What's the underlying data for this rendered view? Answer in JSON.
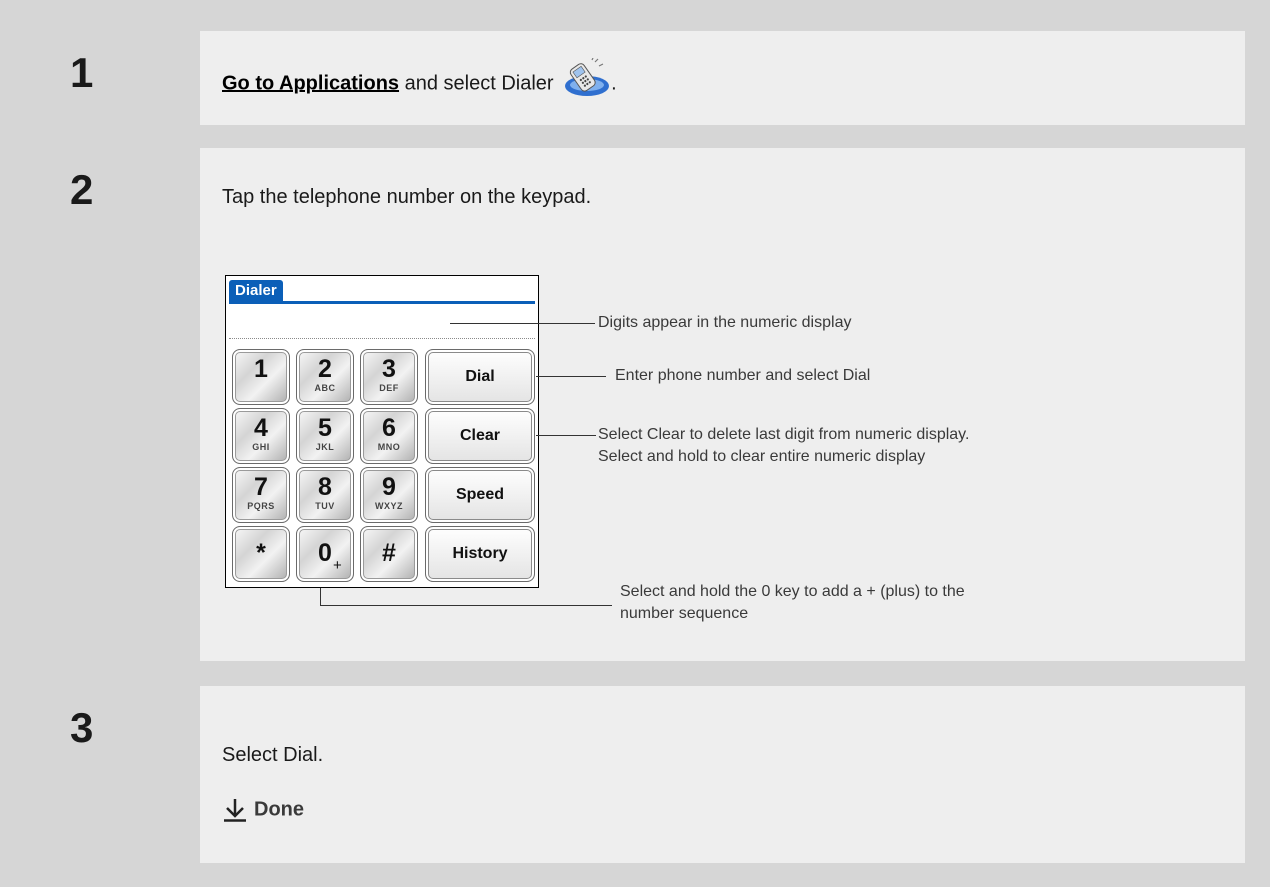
{
  "steps": [
    {
      "number": "1",
      "link_text": "Go to Applications",
      "text_after_link": " and select Dialer",
      "trailing": ".",
      "icon": "dialer-phone-icon"
    },
    {
      "number": "2",
      "text": "Tap the telephone number on the keypad."
    },
    {
      "number": "3",
      "text": "Select Dial.",
      "done_label": "Done",
      "done_icon": "down-arrow-icon"
    }
  ],
  "dialer": {
    "title": "Dialer",
    "keys": [
      {
        "digit": "1",
        "letters": ""
      },
      {
        "digit": "2",
        "letters": "ABC"
      },
      {
        "digit": "3",
        "letters": "DEF"
      },
      {
        "digit": "4",
        "letters": "GHI"
      },
      {
        "digit": "5",
        "letters": "JKL"
      },
      {
        "digit": "6",
        "letters": "MNO"
      },
      {
        "digit": "7",
        "letters": "PQRS"
      },
      {
        "digit": "8",
        "letters": "TUV"
      },
      {
        "digit": "9",
        "letters": "WXYZ"
      },
      {
        "digit": "*",
        "letters": ""
      },
      {
        "digit": "0",
        "letters": "",
        "sub": "+"
      },
      {
        "digit": "#",
        "letters": ""
      }
    ],
    "function_keys": [
      "Dial",
      "Clear",
      "Speed",
      "History"
    ],
    "accent_color": "#0b5fb8"
  },
  "callouts": [
    {
      "text": "Digits appear in the numeric display"
    },
    {
      "text": "Enter phone number and select Dial"
    },
    {
      "text": "Select Clear to delete last digit from numeric display.\nSelect and hold to clear entire numeric display"
    },
    {
      "text": "Select and hold the 0 key to add a + (plus) to the\nnumber sequence"
    }
  ]
}
